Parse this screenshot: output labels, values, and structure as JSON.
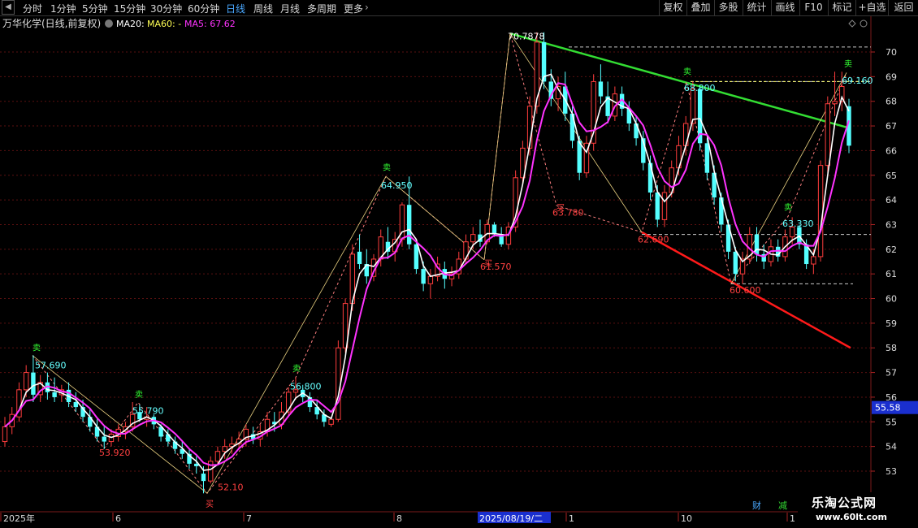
{
  "toolbar": {
    "period_tabs": [
      "分时",
      "1分钟",
      "5分钟",
      "15分钟",
      "30分钟",
      "60分钟",
      "日线",
      "周线",
      "月线",
      "多周期",
      "更多"
    ],
    "active_period": "日线",
    "right_buttons": [
      "复权",
      "叠加",
      "多股",
      "统计",
      "画线",
      "F10",
      "标记",
      "+自选",
      "返回"
    ]
  },
  "legend": {
    "stock_name": "万华化学(日线,前复权)",
    "ma20": "MA20:",
    "ma60": "MA60: -",
    "ma5": "MA5: 67.62"
  },
  "colors": {
    "up": "#ff3d3d",
    "down": "#54ffff",
    "ma5": "#ff33ff",
    "ma20": "#ffffff",
    "trend_upper": "#33dd33",
    "trend_lower": "#ff1a1a",
    "zigzag": "#ff8080",
    "price_tag": "#1a2fcf"
  },
  "chart_data": {
    "type": "candlestick",
    "y_ticks": [
      70.0,
      69.0,
      68.0,
      67.0,
      66.0,
      65.0,
      64.0,
      63.0,
      62.0,
      61.0,
      60.0,
      59.0,
      58.0,
      57.0,
      56.0,
      55.0,
      54.0,
      53.0
    ],
    "y_range": [
      52.4,
      71.4
    ],
    "x_month_labels": [
      "2025年",
      "6",
      "7",
      "8",
      "1",
      "10",
      "1"
    ],
    "cursor_date": "2025/08/19/二",
    "current_price_tag": "55.58",
    "annotations": [
      {
        "text": "57.690",
        "kind": "high"
      },
      {
        "text": "53.920",
        "kind": "low"
      },
      {
        "text": "55.790",
        "kind": "high"
      },
      {
        "text": "52.10",
        "kind": "low"
      },
      {
        "text": "56.800",
        "kind": "high"
      },
      {
        "text": "64.950",
        "kind": "high"
      },
      {
        "text": "61.570",
        "kind": "low"
      },
      {
        "text": "70.7878",
        "kind": "high"
      },
      {
        "text": "63.780",
        "kind": "low"
      },
      {
        "text": "62.690",
        "kind": "low"
      },
      {
        "text": "68.800",
        "kind": "high"
      },
      {
        "text": "60.600",
        "kind": "low"
      },
      {
        "text": "63.330",
        "kind": "high"
      },
      {
        "text": "69.160",
        "kind": "high"
      }
    ],
    "signal_marks": [
      "卖",
      "买"
    ],
    "bottom_badges": [
      "财",
      "减"
    ],
    "candles_ohlc": [
      [
        54.2,
        55.2,
        54.0,
        54.8
      ],
      [
        54.8,
        55.6,
        54.5,
        55.3
      ],
      [
        55.2,
        56.6,
        55.0,
        56.3
      ],
      [
        56.3,
        57.3,
        56.0,
        57.0
      ],
      [
        57.0,
        57.7,
        55.8,
        56.1
      ],
      [
        56.1,
        56.9,
        55.8,
        56.6
      ],
      [
        56.6,
        57.0,
        55.9,
        56.2
      ],
      [
        56.2,
        56.8,
        55.8,
        56.0
      ],
      [
        56.1,
        56.5,
        55.8,
        56.3
      ],
      [
        56.3,
        56.6,
        55.6,
        55.8
      ],
      [
        55.8,
        56.2,
        55.4,
        55.6
      ],
      [
        55.6,
        55.9,
        55.0,
        55.2
      ],
      [
        55.2,
        55.5,
        54.6,
        54.8
      ],
      [
        54.8,
        55.1,
        54.2,
        54.4
      ],
      [
        54.4,
        54.8,
        53.9,
        54.2
      ],
      [
        54.2,
        54.7,
        54.0,
        54.5
      ],
      [
        54.4,
        54.9,
        54.2,
        54.7
      ],
      [
        54.6,
        55.0,
        54.3,
        54.8
      ],
      [
        54.8,
        55.8,
        54.6,
        55.3
      ],
      [
        55.4,
        55.7,
        55.0,
        55.1
      ],
      [
        55.1,
        55.6,
        54.8,
        55.2
      ],
      [
        55.2,
        55.3,
        54.7,
        54.9
      ],
      [
        54.8,
        54.9,
        54.2,
        54.4
      ],
      [
        54.5,
        54.7,
        54.0,
        54.2
      ],
      [
        54.2,
        54.4,
        53.7,
        53.9
      ],
      [
        53.9,
        54.2,
        53.5,
        53.7
      ],
      [
        53.7,
        53.9,
        53.1,
        53.3
      ],
      [
        53.3,
        53.6,
        52.9,
        53.2
      ],
      [
        52.9,
        53.2,
        52.1,
        52.6
      ],
      [
        52.6,
        53.6,
        52.5,
        53.4
      ],
      [
        53.4,
        54.0,
        53.3,
        53.8
      ],
      [
        53.8,
        54.3,
        53.5,
        54.0
      ],
      [
        54.0,
        54.4,
        53.7,
        54.1
      ],
      [
        54.1,
        54.6,
        53.9,
        54.3
      ],
      [
        54.3,
        54.9,
        54.0,
        54.7
      ],
      [
        54.5,
        54.8,
        54.1,
        54.3
      ],
      [
        54.3,
        54.9,
        54.0,
        54.6
      ],
      [
        54.6,
        55.4,
        54.4,
        55.1
      ],
      [
        55.0,
        55.4,
        54.6,
        54.9
      ],
      [
        54.9,
        55.8,
        54.7,
        55.4
      ],
      [
        55.4,
        56.4,
        55.2,
        56.2
      ],
      [
        56.2,
        56.8,
        55.9,
        56.3
      ],
      [
        56.3,
        56.5,
        55.8,
        56.0
      ],
      [
        56.0,
        56.2,
        55.4,
        55.6
      ],
      [
        55.6,
        55.9,
        55.1,
        55.3
      ],
      [
        55.3,
        55.5,
        54.8,
        55.0
      ],
      [
        54.9,
        55.2,
        54.8,
        55.1
      ],
      [
        55.1,
        58.3,
        55.0,
        58.0
      ],
      [
        58.0,
        60.0,
        57.8,
        59.8
      ],
      [
        59.8,
        62.2,
        59.5,
        61.8
      ],
      [
        61.9,
        62.6,
        61.2,
        61.4
      ],
      [
        61.4,
        62.0,
        60.6,
        60.9
      ],
      [
        60.9,
        61.8,
        60.7,
        61.6
      ],
      [
        61.6,
        62.8,
        61.3,
        62.5
      ],
      [
        62.3,
        62.9,
        61.6,
        61.9
      ],
      [
        61.9,
        62.7,
        61.5,
        62.4
      ],
      [
        62.4,
        63.9,
        62.1,
        63.8
      ],
      [
        63.8,
        64.95,
        62.0,
        62.2
      ],
      [
        62.2,
        62.4,
        61.0,
        61.2
      ],
      [
        61.2,
        61.5,
        60.3,
        60.6
      ],
      [
        60.6,
        61.2,
        60.0,
        60.9
      ],
      [
        60.9,
        61.7,
        60.7,
        61.4
      ],
      [
        61.2,
        61.5,
        60.4,
        60.8
      ],
      [
        60.8,
        61.3,
        60.5,
        61.0
      ],
      [
        61.0,
        61.9,
        60.8,
        61.6
      ],
      [
        61.6,
        62.6,
        61.4,
        62.3
      ],
      [
        62.3,
        62.9,
        62.0,
        62.6
      ],
      [
        62.6,
        63.2,
        62.1,
        62.3
      ],
      [
        62.3,
        63.2,
        62.2,
        63.0
      ],
      [
        63.0,
        63.1,
        62.5,
        62.6
      ],
      [
        62.6,
        62.9,
        62.1,
        62.2
      ],
      [
        62.2,
        63.1,
        62.0,
        62.9
      ],
      [
        62.9,
        65.2,
        62.7,
        64.9
      ],
      [
        64.9,
        66.4,
        64.6,
        66.1
      ],
      [
        66.1,
        68.2,
        65.8,
        67.8
      ],
      [
        67.8,
        70.8,
        67.5,
        70.4
      ],
      [
        70.4,
        70.8,
        68.5,
        68.8
      ],
      [
        68.8,
        69.3,
        67.8,
        68.1
      ],
      [
        68.1,
        69.0,
        67.6,
        68.6
      ],
      [
        68.6,
        69.2,
        67.2,
        67.5
      ],
      [
        67.5,
        67.8,
        66.1,
        66.4
      ],
      [
        66.4,
        66.6,
        64.8,
        65.1
      ],
      [
        65.1,
        66.6,
        64.9,
        66.3
      ],
      [
        66.3,
        69.1,
        66.0,
        68.8
      ],
      [
        68.8,
        69.5,
        67.9,
        68.2
      ],
      [
        68.2,
        68.8,
        67.1,
        67.4
      ],
      [
        67.4,
        68.6,
        67.2,
        68.3
      ],
      [
        68.3,
        68.6,
        67.4,
        67.7
      ],
      [
        67.7,
        68.0,
        66.8,
        67.1
      ],
      [
        67.1,
        67.4,
        66.2,
        66.5
      ],
      [
        66.5,
        66.8,
        65.2,
        65.5
      ],
      [
        65.5,
        65.8,
        64.0,
        64.3
      ],
      [
        64.3,
        64.6,
        62.9,
        63.2
      ],
      [
        63.2,
        64.6,
        62.9,
        64.3
      ],
      [
        64.3,
        65.6,
        64.1,
        65.3
      ],
      [
        65.3,
        66.6,
        65.0,
        66.2
      ],
      [
        66.2,
        67.4,
        65.8,
        67.1
      ],
      [
        67.1,
        68.8,
        66.8,
        68.5
      ],
      [
        68.5,
        68.6,
        66.0,
        66.3
      ],
      [
        66.3,
        66.5,
        64.8,
        65.1
      ],
      [
        65.1,
        65.4,
        63.8,
        64.1
      ],
      [
        64.1,
        64.3,
        62.7,
        63.0
      ],
      [
        63.0,
        63.2,
        61.6,
        61.9
      ],
      [
        61.9,
        62.1,
        60.7,
        61.0
      ],
      [
        61.0,
        61.9,
        60.6,
        61.6
      ],
      [
        61.6,
        62.9,
        61.4,
        62.6
      ],
      [
        62.6,
        62.9,
        61.5,
        61.8
      ],
      [
        61.8,
        62.2,
        61.2,
        61.5
      ],
      [
        61.5,
        62.4,
        61.3,
        62.1
      ],
      [
        62.1,
        62.4,
        61.5,
        61.7
      ],
      [
        61.7,
        62.8,
        61.5,
        62.5
      ],
      [
        62.5,
        63.3,
        62.2,
        62.9
      ],
      [
        62.9,
        63.0,
        62.0,
        62.2
      ],
      [
        62.2,
        62.4,
        61.2,
        61.4
      ],
      [
        61.4,
        62.0,
        61.0,
        61.7
      ],
      [
        61.7,
        65.6,
        61.5,
        65.4
      ],
      [
        65.4,
        68.2,
        65.1,
        67.9
      ],
      [
        67.9,
        69.2,
        67.4,
        68.0
      ],
      [
        68.0,
        69.2,
        67.6,
        68.6
      ],
      [
        67.8,
        68.1,
        65.9,
        66.2
      ]
    ]
  }
}
